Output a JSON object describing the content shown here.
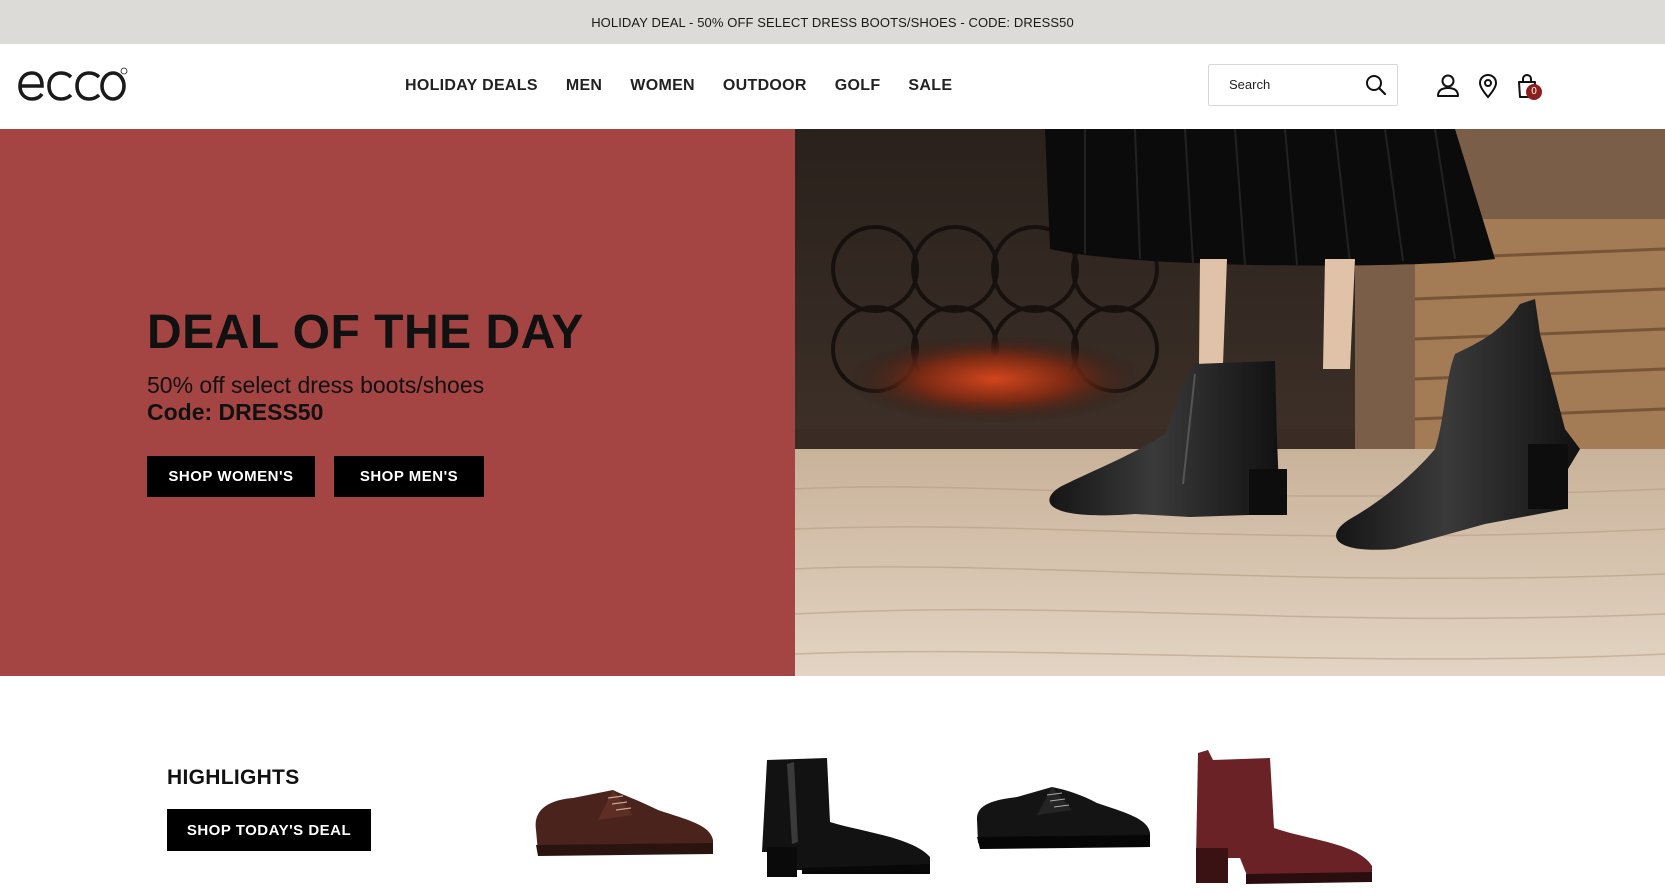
{
  "promo": {
    "text": "HOLIDAY DEAL - 50% OFF SELECT DRESS BOOTS/SHOES - CODE: DRESS50"
  },
  "header": {
    "logo_text": "ecco",
    "nav": [
      "HOLIDAY DEALS",
      "MEN",
      "WOMEN",
      "OUTDOOR",
      "GOLF",
      "SALE"
    ],
    "search": {
      "placeholder": "Search"
    },
    "icons": [
      "search-icon",
      "account-icon",
      "store-locator-icon",
      "bag-icon"
    ],
    "cart_count": "0"
  },
  "hero": {
    "title": "DEAL OF THE DAY",
    "subtitle": "50% off select dress boots/shoes",
    "code_line": "Code: DRESS50",
    "buttons": [
      "SHOP WOMEN'S",
      "SHOP MEN'S"
    ],
    "bg_color": "#a44544"
  },
  "highlights": {
    "title": "HIGHLIGHTS",
    "button": "SHOP TODAY'S DEAL",
    "products": [
      "brown-derby-shoe",
      "black-ankle-boot",
      "black-oxford-shoe",
      "burgundy-suede-boot"
    ]
  },
  "colors": {
    "accent": "#a44544",
    "badge": "#8d1f1f",
    "promo_bg": "#dddbd7"
  }
}
